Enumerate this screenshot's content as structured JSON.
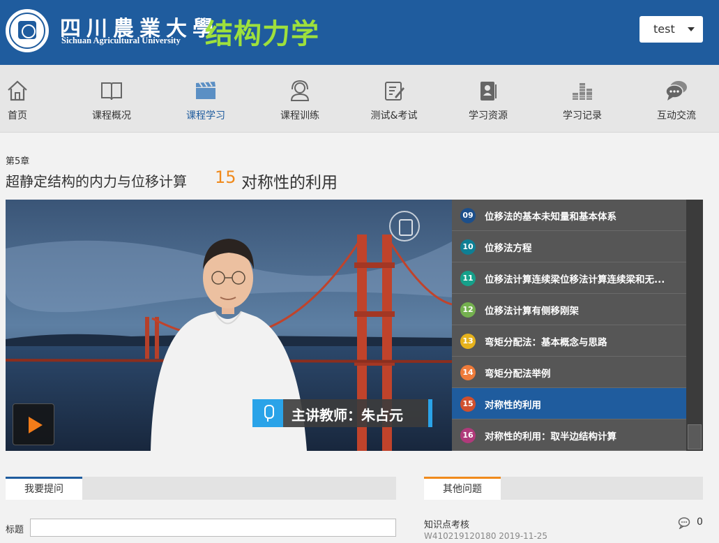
{
  "header": {
    "logo_cn": "四川農業大學",
    "logo_en": "Sichuan Agricultural University",
    "site_title": "结构力学",
    "user": "test"
  },
  "nav": [
    {
      "label": "首页",
      "icon": "home-icon"
    },
    {
      "label": "课程概况",
      "icon": "book-icon"
    },
    {
      "label": "课程学习",
      "icon": "clapperboard-icon",
      "active": true
    },
    {
      "label": "课程训练",
      "icon": "headset-icon"
    },
    {
      "label": "测试&考试",
      "icon": "edit-icon"
    },
    {
      "label": "学习资源",
      "icon": "resource-icon"
    },
    {
      "label": "学习记录",
      "icon": "chart-icon"
    },
    {
      "label": "互动交流",
      "icon": "chat-icon"
    }
  ],
  "chapter": {
    "label": "第5章",
    "title": "超静定结构的内力与位移计算",
    "lesson_num": "15",
    "lesson_title": "对称性的利用"
  },
  "video": {
    "teacher": "主讲教师：朱占元"
  },
  "playlist": [
    {
      "num": "09",
      "title": "位移法的基本未知量和基本体系",
      "color": "#1d4f8a"
    },
    {
      "num": "10",
      "title": "位移法方程",
      "color": "#0e7f94"
    },
    {
      "num": "11",
      "title": "位移法计算连续梁位移法计算连续梁和无...",
      "color": "#16a08a"
    },
    {
      "num": "12",
      "title": "位移法计算有侧移刚架",
      "color": "#74b04f"
    },
    {
      "num": "13",
      "title": "弯矩分配法：基本概念与思路",
      "color": "#e6b21c"
    },
    {
      "num": "14",
      "title": "弯矩分配法举例",
      "color": "#ef7b3a"
    },
    {
      "num": "15",
      "title": "对称性的利用",
      "color": "#d0502e",
      "active": true
    },
    {
      "num": "16",
      "title": "对称性的利用：取半边结构计算",
      "color": "#b03a7a"
    }
  ],
  "ask": {
    "tab": "我要提问",
    "field_label": "标题",
    "field_value": ""
  },
  "others": {
    "tab": "其他问题",
    "items": [
      {
        "title": "知识点考核",
        "meta": "W410219120180 2019-11-25",
        "comments": "0"
      }
    ]
  }
}
